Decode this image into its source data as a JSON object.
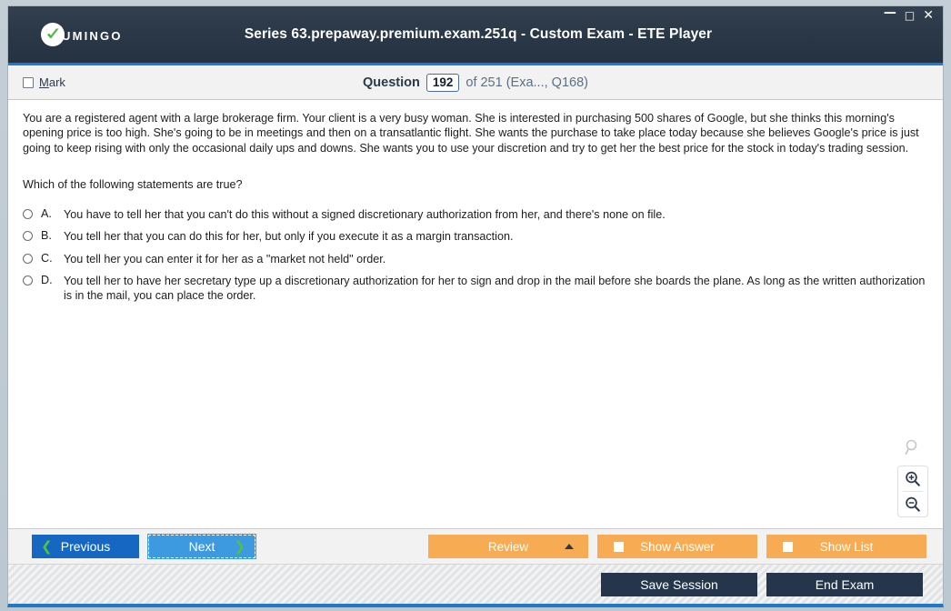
{
  "window": {
    "title": "Series 63.prepaway.premium.exam.251q - Custom Exam - ETE Player",
    "logo_text": "UMINGO",
    "controls": {
      "minimize": "—",
      "maximize": "□",
      "close": "✕"
    },
    "accent_blue": "#1b7ad4",
    "titlebar_color": "#2b3848",
    "orange": "#f7ac53",
    "dark_button": "#25354b"
  },
  "header": {
    "mark_label": "Mark",
    "mark_accel": "M",
    "mark_rest": "ark",
    "question_word": "Question",
    "question_number": "192",
    "question_of": "of 251 (Exa..., Q168)"
  },
  "question": {
    "body": "You are a registered agent with a large brokerage firm. Your client is a very busy woman. She is interested in purchasing 500 shares of Google, but she thinks this morning's opening price is too high. She's going to be in meetings and then on a transatlantic flight. She wants the purchase to take place today because she believes Google's price is just going to keep rising with only the occasional daily ups and downs. She wants you to use your discretion and try to get her the best price for the stock in today's trading session.",
    "prompt": "Which of the following statements are true?",
    "options": [
      {
        "letter": "A.",
        "text": "You have to tell her that you can't do this without a signed discretionary authorization from her, and there's none on file.",
        "selected": false
      },
      {
        "letter": "B.",
        "text": "You tell her that you can do this for her, but only if you execute it as a margin transaction.",
        "selected": false
      },
      {
        "letter": "C.",
        "text": "You tell her you can enter it for her as a \"market not held\" order.",
        "selected": false
      },
      {
        "letter": "D.",
        "text": "You tell her to have her secretary type up a discretionary authorization for her to sign and drop in the mail before she boards the plane. As long as the written authorization is in the mail, you can place the order.",
        "selected": false
      }
    ]
  },
  "zoom_tools": {
    "reset_icon": "magnifier-icon",
    "zoom_in_icon": "zoom-in-icon",
    "zoom_out_icon": "zoom-out-icon"
  },
  "actions": {
    "previous": "Previous",
    "next": "Next",
    "review": "Review",
    "show_answer": "Show Answer",
    "show_list": "Show List"
  },
  "footer": {
    "save_session": "Save Session",
    "end_exam": "End Exam"
  }
}
